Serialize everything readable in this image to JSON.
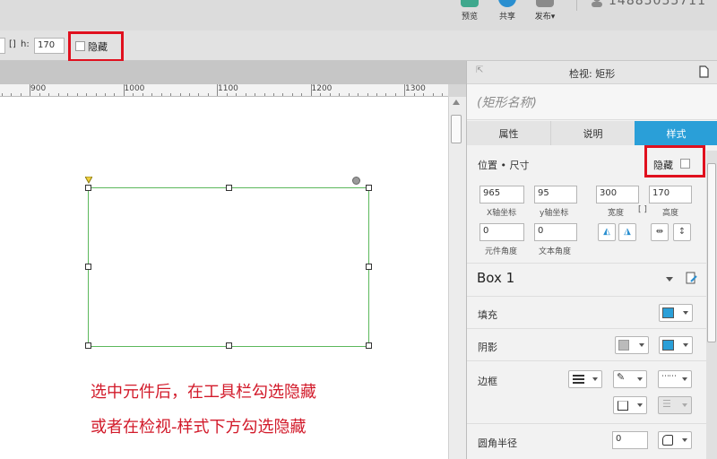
{
  "toolbar": {
    "preview_label": "预览",
    "share_label": "共享",
    "publish_label": "发布▾",
    "user_id": "14885055711"
  },
  "propbar": {
    "height_label": "h:",
    "height_value": "170",
    "hide_label": "隐藏"
  },
  "ruler": {
    "ticks": [
      "900",
      "1000",
      "1100",
      "1200",
      "1300"
    ]
  },
  "canvas": {
    "note_line1": "选中元件后，在工具栏勾选隐藏",
    "note_line2": "或者在检视-样式下方勾选隐藏"
  },
  "inspector": {
    "title": "检视: 矩形",
    "shape_name_placeholder": "(矩形名称)",
    "tabs": [
      "属性",
      "说明",
      "样式"
    ],
    "active_tab": "样式",
    "position_size_label": "位置 • 尺寸",
    "hide_label": "隐藏",
    "x_value": "965",
    "x_label": "X轴坐标",
    "y_value": "95",
    "y_label": "y轴坐标",
    "width_value": "300",
    "width_label": "宽度",
    "height_value": "170",
    "height_label": "高度",
    "rotation_value": "0",
    "rotation_label": "元件角度",
    "text_rotation_value": "0",
    "text_rotation_label": "文本角度",
    "style_name": "Box 1",
    "fill_label": "填充",
    "shadow_label": "阴影",
    "border_label": "边框",
    "corner_radius_label": "圆角半径",
    "corner_radius_value": "0"
  },
  "colors": {
    "accent": "#2a9fd8",
    "highlight_red": "#e0101e",
    "shape_border": "#5cb85c",
    "note_red": "#d21a2a"
  }
}
